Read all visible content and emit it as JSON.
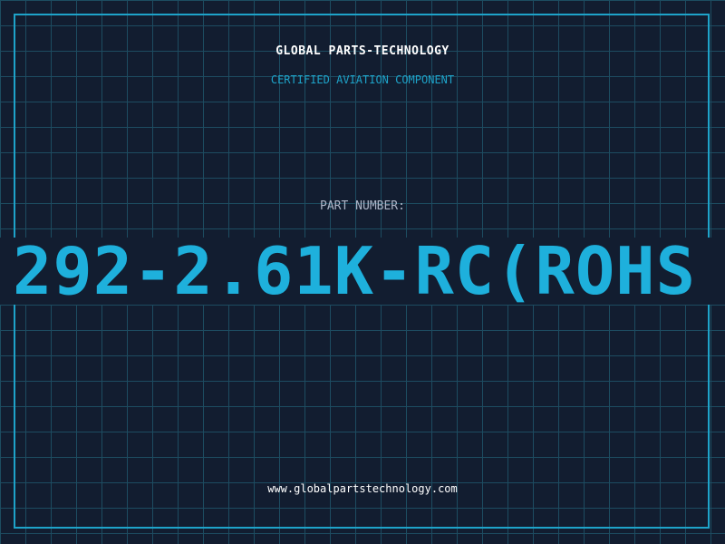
{
  "header": {
    "brand": "GLOBAL PARTS-TECHNOLOGY",
    "tagline": "CERTIFIED AVIATION COMPONENT"
  },
  "part": {
    "label": "PART NUMBER:",
    "number": "292-2.61K-RC(ROHS"
  },
  "footer": {
    "website": "www.globalpartstechnology.com"
  },
  "colors": {
    "background": "#121d30",
    "grid": "#1d4c61",
    "frame": "#1ea3c9",
    "accent": "#1eb0dc",
    "text": "#ffffff",
    "muted": "#aeb6c8"
  }
}
